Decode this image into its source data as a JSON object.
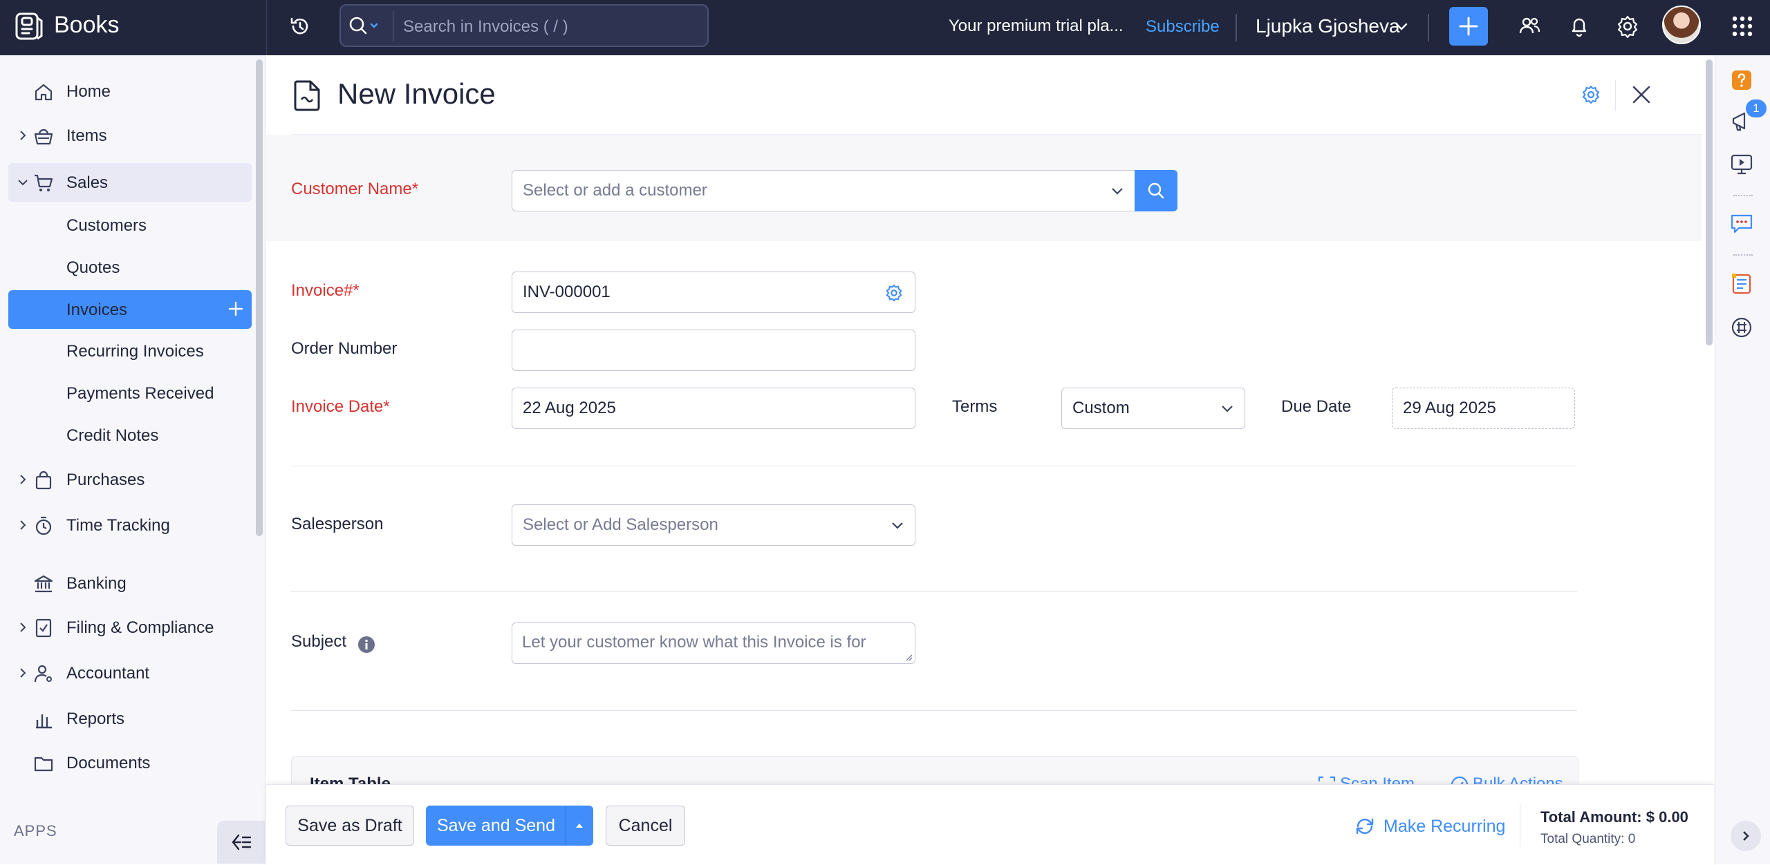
{
  "app": {
    "name": "Books"
  },
  "topbar": {
    "search_placeholder": "Search in Invoices ( / )",
    "trial_text": "Your premium trial pla...",
    "subscribe_label": "Subscribe",
    "user_name": "Ljupka Gjosheva"
  },
  "sidebar": {
    "items": [
      {
        "label": "Home",
        "icon": "home-icon"
      },
      {
        "label": "Items",
        "icon": "basket-icon"
      },
      {
        "label": "Sales",
        "icon": "cart-icon"
      },
      {
        "label": "Customers"
      },
      {
        "label": "Quotes"
      },
      {
        "label": "Invoices"
      },
      {
        "label": "Recurring Invoices"
      },
      {
        "label": "Payments Received"
      },
      {
        "label": "Credit Notes"
      },
      {
        "label": "Purchases",
        "icon": "shopping-bag-icon"
      },
      {
        "label": "Time Tracking",
        "icon": "stopwatch-icon"
      },
      {
        "label": "Banking",
        "icon": "bank-icon"
      },
      {
        "label": "Filing & Compliance",
        "icon": "document-check-icon"
      },
      {
        "label": "Accountant",
        "icon": "accountant-icon"
      },
      {
        "label": "Reports",
        "icon": "bar-chart-icon"
      },
      {
        "label": "Documents",
        "icon": "folder-icon"
      }
    ],
    "apps_label": "APPS"
  },
  "page": {
    "title": "New Invoice"
  },
  "form": {
    "customer_name_label": "Customer Name*",
    "customer_placeholder": "Select or add a customer",
    "invoice_number_label": "Invoice#*",
    "invoice_number_value": "INV-000001",
    "order_number_label": "Order Number",
    "order_number_value": "",
    "invoice_date_label": "Invoice Date*",
    "invoice_date_value": "22 Aug 2025",
    "terms_label": "Terms",
    "terms_value": "Custom",
    "due_date_label": "Due Date",
    "due_date_value": "29 Aug 2025",
    "salesperson_label": "Salesperson",
    "salesperson_placeholder": "Select or Add Salesperson",
    "subject_label": "Subject",
    "subject_placeholder": "Let your customer know what this Invoice is for"
  },
  "item_table": {
    "title": "Item Table",
    "scan_item_label": "Scan Item",
    "bulk_actions_label": "Bulk Actions"
  },
  "actions": {
    "save_draft_label": "Save as Draft",
    "save_send_label": "Save and Send",
    "cancel_label": "Cancel",
    "make_recurring_label": "Make Recurring",
    "total_amount_text": "Total Amount: $ 0.00",
    "total_quantity_text": "Total Quantity: 0"
  },
  "rail": {
    "notification_count": "1"
  },
  "colors": {
    "accent": "#408dfb",
    "topbar_bg": "#21263c",
    "required_label": "#d6332f",
    "sidebar_bg": "#f7f7fb"
  }
}
